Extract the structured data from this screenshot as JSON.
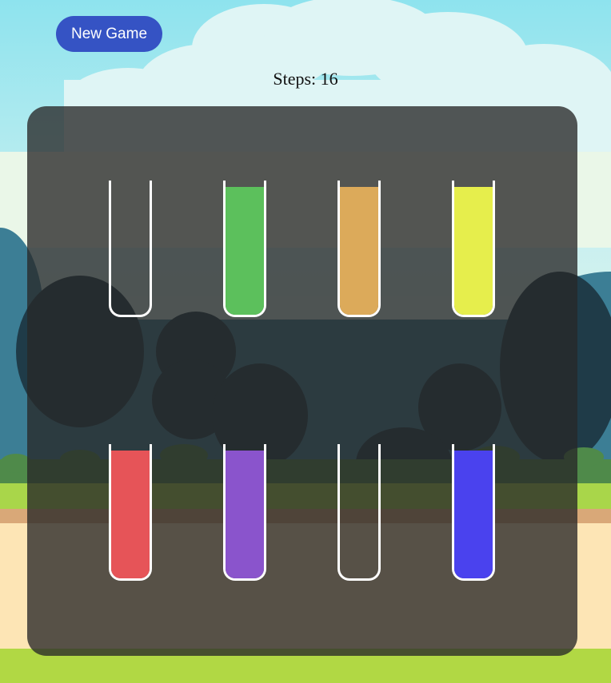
{
  "header": {
    "new_game_label": "New Game",
    "steps_prefix": "Steps: ",
    "steps_value": "16"
  },
  "tubes": [
    {
      "row": 0,
      "col": 0,
      "color": null,
      "fill": 0
    },
    {
      "row": 0,
      "col": 1,
      "color": "#5cc05c",
      "fill": 0.95
    },
    {
      "row": 0,
      "col": 2,
      "color": "#dcaa5a",
      "fill": 0.95
    },
    {
      "row": 0,
      "col": 3,
      "color": "#e6ee4c",
      "fill": 0.95
    },
    {
      "row": 1,
      "col": 0,
      "color": "#e65458",
      "fill": 0.95
    },
    {
      "row": 1,
      "col": 1,
      "color": "#8a54cc",
      "fill": 0.95
    },
    {
      "row": 1,
      "col": 2,
      "color": null,
      "fill": 0
    },
    {
      "row": 1,
      "col": 3,
      "color": "#4a42ee",
      "fill": 0.95
    }
  ]
}
